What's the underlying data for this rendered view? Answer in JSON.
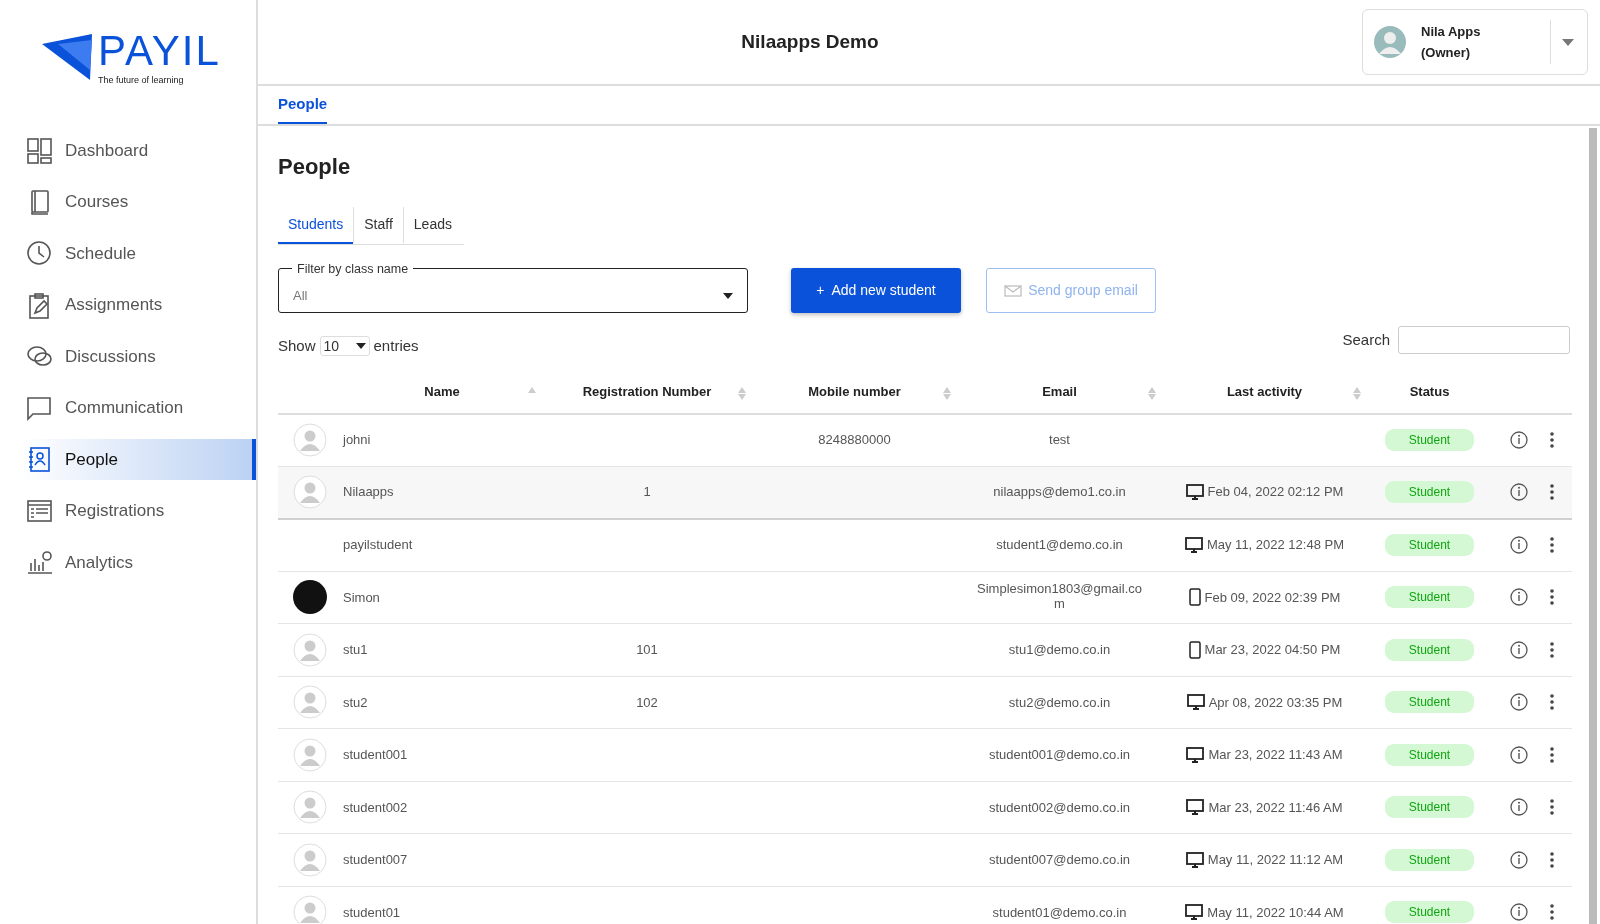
{
  "sidebar": {
    "logo": {
      "name": "PAYIL",
      "tagline": "The future of learning"
    },
    "items": [
      {
        "label": "Dashboard",
        "kind": "dashboard",
        "selected": false
      },
      {
        "label": "Courses",
        "kind": "book",
        "selected": false
      },
      {
        "label": "Schedule",
        "kind": "clock",
        "selected": false
      },
      {
        "label": "Assignments",
        "kind": "clipboard",
        "selected": false
      },
      {
        "label": "Discussions",
        "kind": "chat",
        "selected": false
      },
      {
        "label": "Communication",
        "kind": "message",
        "selected": false
      },
      {
        "label": "People",
        "kind": "contacts",
        "selected": true
      },
      {
        "label": "Registrations",
        "kind": "form",
        "selected": false
      },
      {
        "label": "Analytics",
        "kind": "chart",
        "selected": false
      }
    ]
  },
  "header": {
    "title": "Nilaapps Demo",
    "user": {
      "name": "Nila Apps",
      "role": "(Owner)"
    }
  },
  "breadcrumb_tabs": [
    {
      "label": "People",
      "selected": true
    }
  ],
  "page_title": "People",
  "tabs": [
    {
      "label": "Students",
      "selected": true
    },
    {
      "label": "Staff",
      "selected": false
    },
    {
      "label": "Leads",
      "selected": false
    }
  ],
  "filter": {
    "label": "Filter by class name",
    "value": "All"
  },
  "buttons": [
    {
      "label": "Add new student",
      "icon": "+",
      "kind": "primary"
    },
    {
      "label": "Send group email",
      "kind": "outline",
      "disabled": true
    }
  ],
  "entries": {
    "before": "Show",
    "value": "10",
    "after": "entries"
  },
  "search": {
    "label": "Search"
  },
  "table": {
    "columns": [
      {
        "label": "Name",
        "kind": "sorted"
      },
      {
        "label": "Registration Number",
        "kind": "sortable"
      },
      {
        "label": "Mobile number",
        "kind": "sortable"
      },
      {
        "label": "Email",
        "kind": "sortable"
      },
      {
        "label": "Last activity",
        "kind": "sortable"
      },
      {
        "label": "Status",
        "kind": "plain"
      }
    ],
    "rows": [
      {
        "avatar": {
          "kind": "default"
        },
        "name": "johni",
        "registration": "",
        "mobile": "8248880000",
        "email": "test",
        "last_activity": "",
        "status": "Student",
        "highlighted": false
      },
      {
        "avatar": {
          "kind": "default"
        },
        "name": "Nilaapps",
        "registration": "1",
        "mobile": "",
        "email": "nilaapps@demo1.co.in",
        "device": {
          "kind": "desktop"
        },
        "last_activity": "Feb 04, 2022 02:12 PM",
        "status": "Student",
        "highlighted": true
      },
      {
        "name": "payilstudent",
        "registration": "",
        "mobile": "",
        "email": "student1@demo.co.in",
        "device": {
          "kind": "desktop"
        },
        "last_activity": "May 11, 2022 12:48 PM",
        "status": "Student",
        "highlighted": false
      },
      {
        "avatar": {
          "kind": "photo"
        },
        "name": "Simon",
        "registration": "",
        "mobile": "",
        "email": "Simplesimon1803@gmail.com",
        "device": {
          "kind": "mobile"
        },
        "last_activity": "Feb 09, 2022 02:39 PM",
        "status": "Student",
        "highlighted": false
      },
      {
        "avatar": {
          "kind": "default"
        },
        "name": "stu1",
        "registration": "101",
        "mobile": "",
        "email": "stu1@demo.co.in",
        "device": {
          "kind": "mobile"
        },
        "last_activity": "Mar 23, 2022 04:50 PM",
        "status": "Student",
        "highlighted": false
      },
      {
        "avatar": {
          "kind": "default"
        },
        "name": "stu2",
        "registration": "102",
        "mobile": "",
        "email": "stu2@demo.co.in",
        "device": {
          "kind": "desktop"
        },
        "last_activity": "Apr 08, 2022 03:35 PM",
        "status": "Student",
        "highlighted": false
      },
      {
        "avatar": {
          "kind": "default"
        },
        "name": "student001",
        "registration": "",
        "mobile": "",
        "email": "student001@demo.co.in",
        "device": {
          "kind": "desktop"
        },
        "last_activity": "Mar 23, 2022 11:43 AM",
        "status": "Student",
        "highlighted": false
      },
      {
        "avatar": {
          "kind": "default"
        },
        "name": "student002",
        "registration": "",
        "mobile": "",
        "email": "student002@demo.co.in",
        "device": {
          "kind": "desktop"
        },
        "last_activity": "Mar 23, 2022 11:46 AM",
        "status": "Student",
        "highlighted": false
      },
      {
        "avatar": {
          "kind": "default"
        },
        "name": "student007",
        "registration": "",
        "mobile": "",
        "email": "student007@demo.co.in",
        "device": {
          "kind": "desktop"
        },
        "last_activity": "May 11, 2022 11:12 AM",
        "status": "Student",
        "highlighted": false
      },
      {
        "avatar": {
          "kind": "default"
        },
        "name": "student01",
        "registration": "",
        "mobile": "",
        "email": "student01@demo.co.in",
        "device": {
          "kind": "desktop"
        },
        "last_activity": "May 11, 2022 10:44 AM",
        "status": "Student",
        "highlighted": false
      }
    ]
  }
}
